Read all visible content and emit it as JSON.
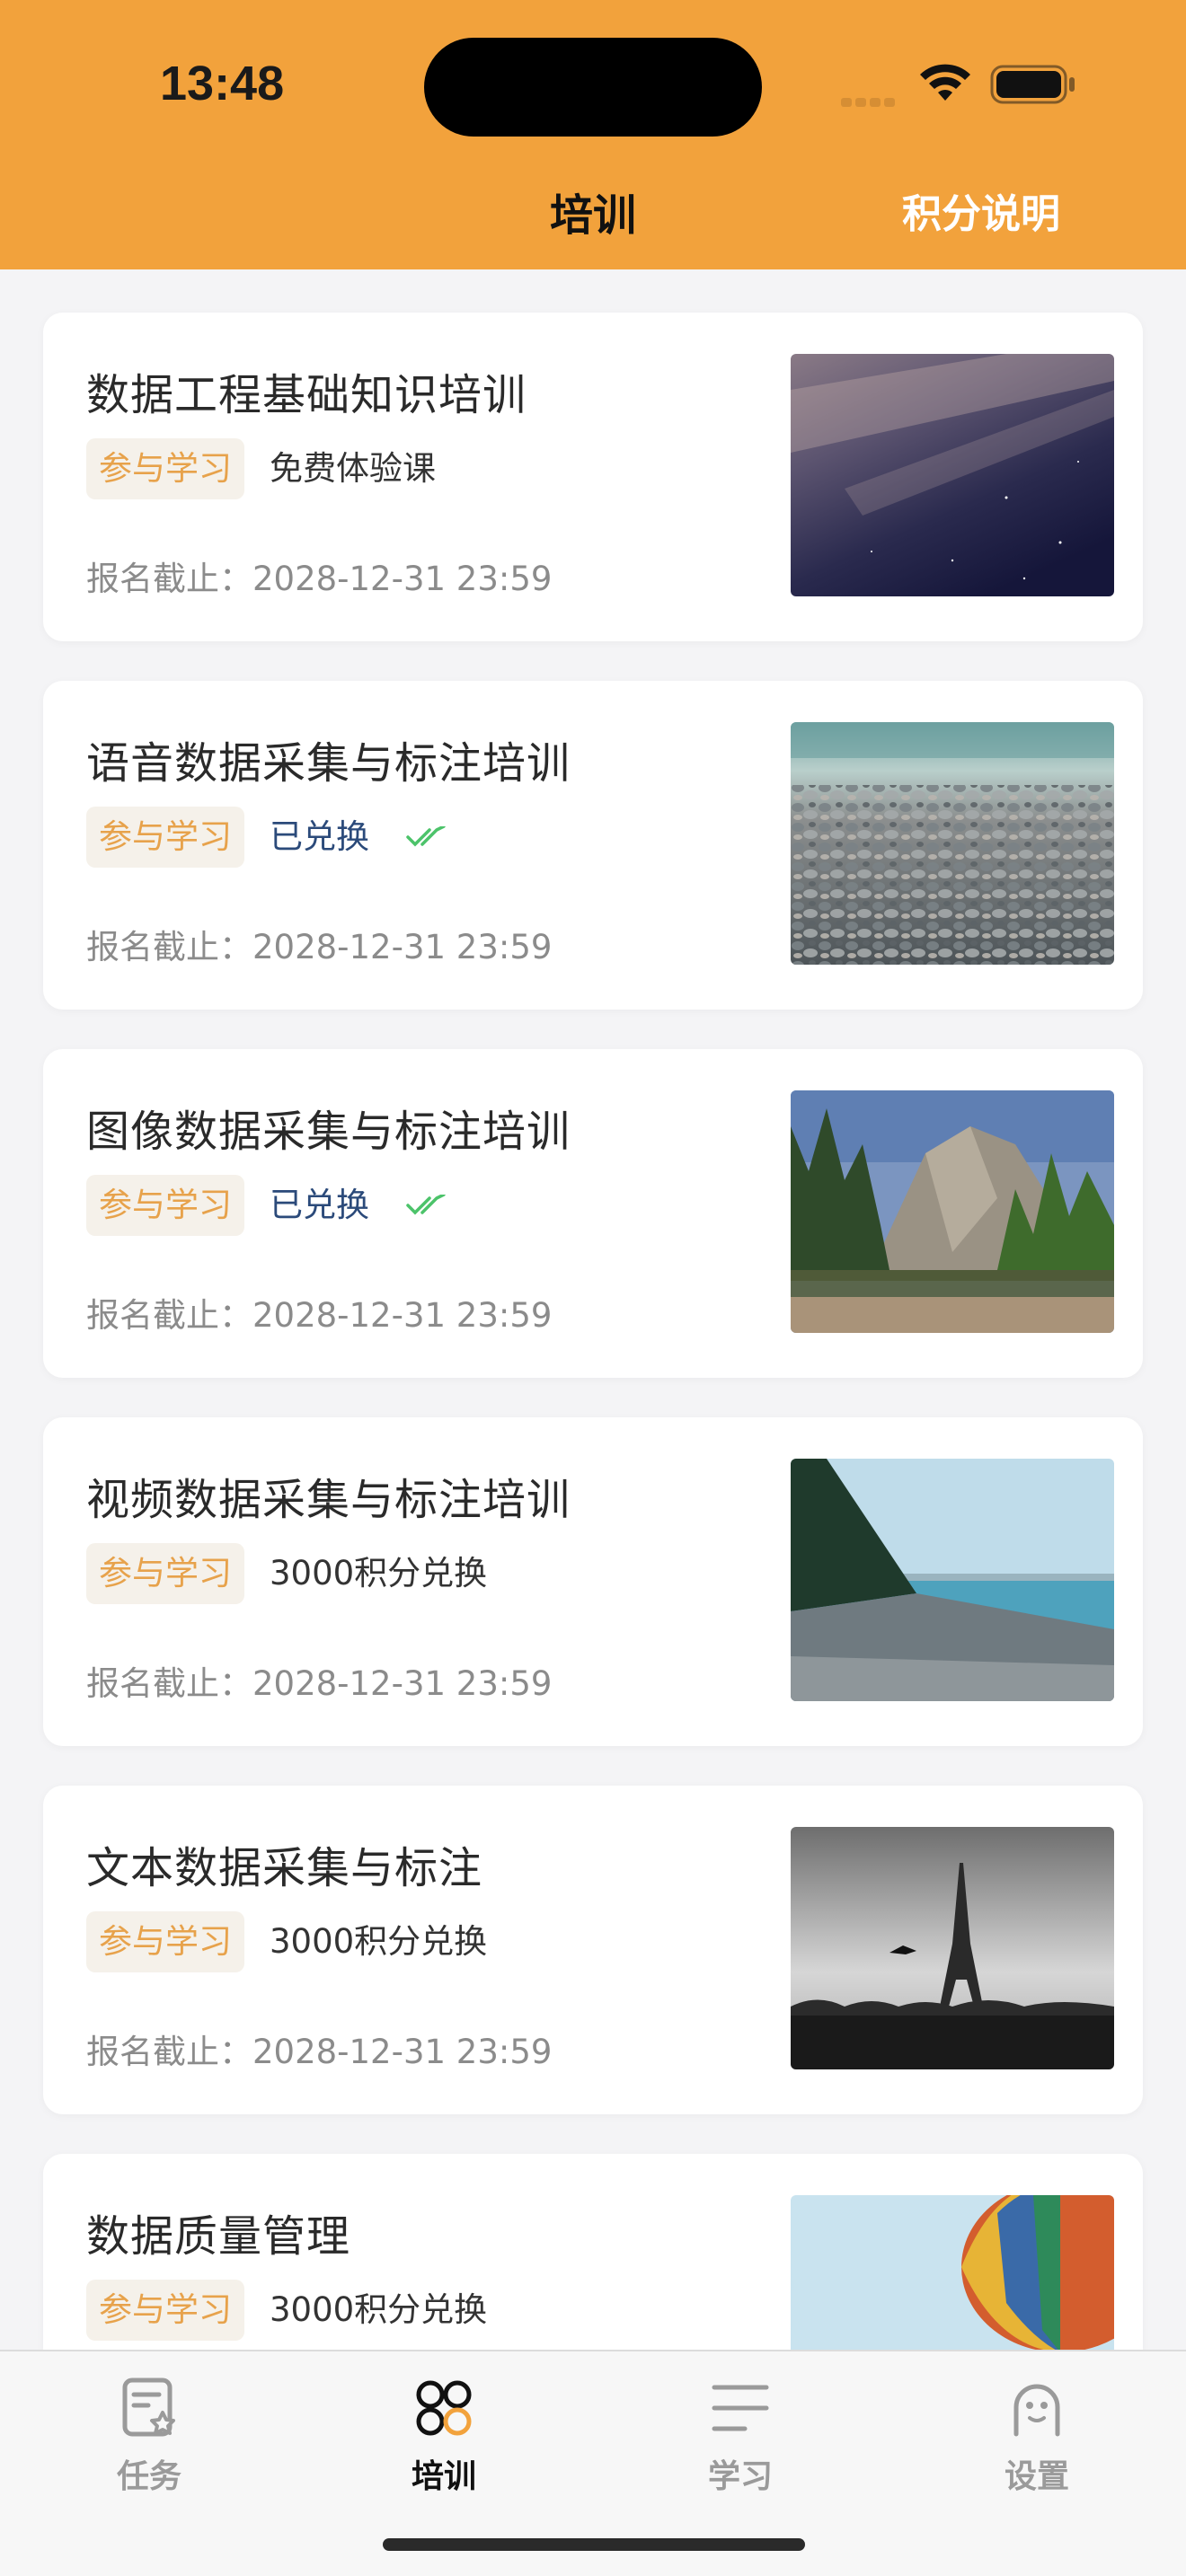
{
  "status_bar": {
    "time": "13:48"
  },
  "nav": {
    "title": "培训",
    "right_action": "积分说明"
  },
  "courses": [
    {
      "title": "数据工程基础知识培训",
      "tag": "参与学习",
      "status": "免费体验课",
      "deadline": "报名截止：2028-12-31 23:59",
      "thumbnail": "night-sky-image"
    },
    {
      "title": "语音数据采集与标注培训",
      "tag": "参与学习",
      "status": "已兑换",
      "deadline": "报名截止：2028-12-31 23:59",
      "thumbnail": "pebble-beach-image"
    },
    {
      "title": "图像数据采集与标注培训",
      "tag": "参与学习",
      "status": "已兑换",
      "deadline": "报名截止：2028-12-31 23:59",
      "thumbnail": "mountain-forest-image"
    },
    {
      "title": "视频数据采集与标注培训",
      "tag": "参与学习",
      "status": "3000积分兑换",
      "deadline": "报名截止：2028-12-31 23:59",
      "thumbnail": "lake-shore-image"
    },
    {
      "title": "文本数据采集与标注",
      "tag": "参与学习",
      "status": "3000积分兑换",
      "deadline": "报名截止：2028-12-31 23:59",
      "thumbnail": "eiffel-tower-image"
    },
    {
      "title": "数据质量管理",
      "tag": "参与学习",
      "status": "3000积分兑换",
      "deadline": "",
      "thumbnail": "hot-air-balloon-image"
    }
  ],
  "tabbar": {
    "tabs": [
      {
        "label": "任务",
        "icon": "task-icon"
      },
      {
        "label": "培训",
        "icon": "training-icon",
        "active": true
      },
      {
        "label": "学习",
        "icon": "study-icon"
      },
      {
        "label": "设置",
        "icon": "settings-icon"
      }
    ]
  },
  "colors": {
    "header": "#f2a23c",
    "tag_text": "#e7a24b",
    "tag_bg": "#f5f1ea",
    "exchanged": "#2b4a7a",
    "check": "#4cc36a"
  }
}
